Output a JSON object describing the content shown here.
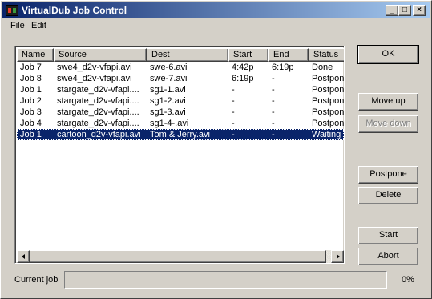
{
  "window": {
    "title": "VirtualDub Job Control"
  },
  "menu": {
    "file_label": "File",
    "edit_label": "Edit"
  },
  "list": {
    "columns": [
      "Name",
      "Source",
      "Dest",
      "Start",
      "End",
      "Status"
    ],
    "rows": [
      [
        "Job 7",
        "swe4_d2v-vfapi.avi",
        "swe-6.avi",
        "4:42p",
        "6:19p",
        "Done"
      ],
      [
        "Job 8",
        "swe4_d2v-vfapi.avi",
        "swe-7.avi",
        "6:19p",
        "-",
        "Postpone"
      ],
      [
        "Job 1",
        "stargate_d2v-vfapi....",
        "sg1-1.avi",
        "-",
        "-",
        "Postpone"
      ],
      [
        "Job 2",
        "stargate_d2v-vfapi....",
        "sg1-2.avi",
        "-",
        "-",
        "Postpone"
      ],
      [
        "Job 3",
        "stargate_d2v-vfapi....",
        "sg1-3.avi",
        "-",
        "-",
        "Postpone"
      ],
      [
        "Job 4",
        "stargate_d2v-vfapi....",
        "sg1-4-.avi",
        "-",
        "-",
        "Postpone"
      ],
      [
        "Job 1",
        "cartoon_d2v-vfapi.avi",
        "Tom & Jerry.avi",
        "-",
        "-",
        "Waiting"
      ]
    ],
    "selected_index": 6
  },
  "buttons": {
    "ok": "OK",
    "move_up": "Move up",
    "move_down": "Move down",
    "postpone": "Postpone",
    "delete": "Delete",
    "start": "Start",
    "abort": "Abort"
  },
  "status": {
    "current_job_label": "Current job",
    "progress_text": "0%",
    "progress": 0
  },
  "colors": {
    "titlebar_start": "#0a246a",
    "titlebar_end": "#a6caf0",
    "selection": "#0a246a",
    "face": "#d4d0c8"
  },
  "icons": [
    "app-icon",
    "minimize-icon",
    "maximize-icon",
    "close-icon",
    "scroll-left-icon",
    "scroll-right-icon"
  ]
}
